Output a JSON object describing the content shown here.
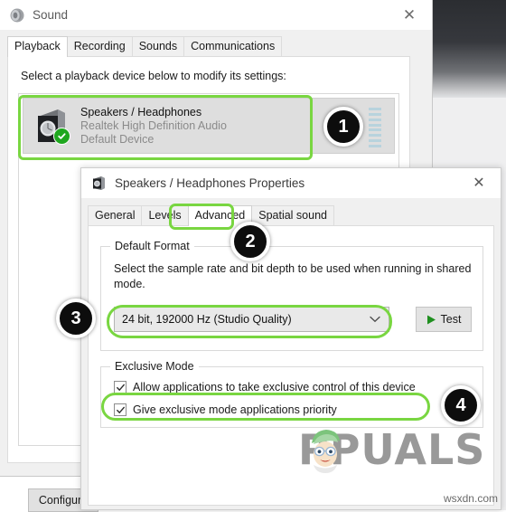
{
  "sound_window": {
    "title": "Sound",
    "title_icon": "speaker-icon",
    "close_label": "✕",
    "tabs": [
      {
        "label": "Playback",
        "active": true
      },
      {
        "label": "Recording",
        "active": false
      },
      {
        "label": "Sounds",
        "active": false
      },
      {
        "label": "Communications",
        "active": false
      }
    ],
    "instruction": "Select a playback device below to modify its settings:",
    "device": {
      "name": "Speakers / Headphones",
      "driver": "Realtek High Definition Audio",
      "status": "Default Device",
      "icon": "speaker-box-icon",
      "check_icon": "green-check-icon",
      "meter_icon": "volume-meter-icon"
    },
    "configure_button": "Configure"
  },
  "properties_window": {
    "title": "Speakers / Headphones Properties",
    "title_icon": "speaker-box-icon",
    "close_label": "✕",
    "tabs": [
      {
        "label": "General",
        "active": false
      },
      {
        "label": "Levels",
        "active": false
      },
      {
        "label": "Advanced",
        "active": true
      },
      {
        "label": "Spatial sound",
        "active": false
      }
    ],
    "default_format": {
      "legend": "Default Format",
      "description": "Select the sample rate and bit depth to be used when running in shared mode.",
      "selected_value": "24 bit, 192000 Hz (Studio Quality)",
      "caret_icon": "chevron-down-icon",
      "test_button": "Test",
      "test_icon": "play-icon"
    },
    "exclusive_mode": {
      "legend": "Exclusive Mode",
      "checkboxes": [
        {
          "label": "Allow applications to take exclusive control of this device",
          "checked": true
        },
        {
          "label": "Give exclusive mode applications priority",
          "checked": true
        }
      ]
    }
  },
  "annotations": {
    "highlight_color": "#79d641",
    "badges": [
      {
        "number": "1"
      },
      {
        "number": "2"
      },
      {
        "number": "3"
      },
      {
        "number": "4"
      }
    ]
  },
  "watermark": {
    "text": "PPUALS",
    "mascot_icon": "appuals-mascot-icon"
  },
  "source_tag": "wsxdn.com"
}
